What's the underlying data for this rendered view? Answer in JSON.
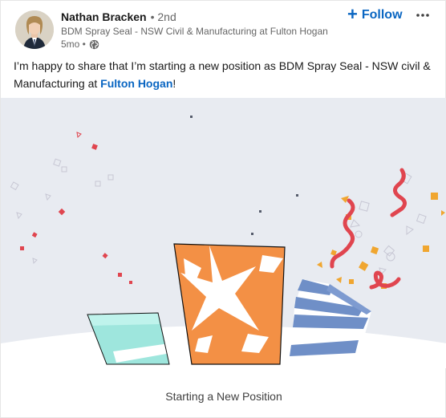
{
  "post": {
    "actor": {
      "name": "Nathan Bracken",
      "degree": "• 2nd",
      "headline": "BDM Spray Seal - NSW Civil & Manufacturing at Fulton Hogan",
      "time": "5mo •",
      "visibility_icon": "globe-icon"
    },
    "follow": {
      "label": "Follow",
      "icon": "plus-icon"
    },
    "more_icon": "ellipsis-icon",
    "text": {
      "before_link": "I’m happy to share that I’m starting a new position as BDM Spray Seal - NSW civil & Manufacturing at ",
      "link": "Fulton Hogan",
      "after_link": "!"
    },
    "celebration": {
      "caption": "Starting a New Position",
      "background_color": "#e8ebf1"
    }
  },
  "colors": {
    "accent": "#0a66c2",
    "confetti_red": "#e0454f",
    "confetti_gold": "#f0a630",
    "orange": "#f39045",
    "blue_stripe": "#6f8fc7",
    "mint": "#9ee6dd"
  }
}
